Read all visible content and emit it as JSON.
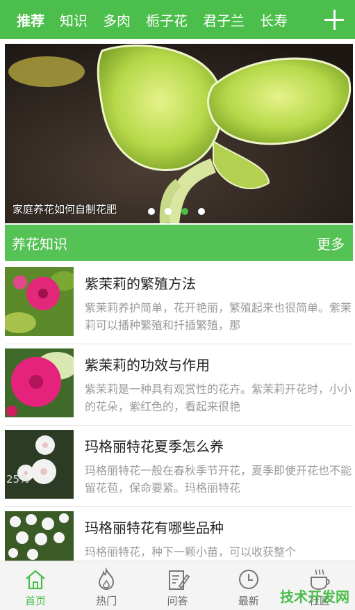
{
  "topbar": {
    "tabs": [
      "推荐",
      "知识",
      "多肉",
      "栀子花",
      "君子兰",
      "长寿"
    ],
    "add_icon": "plus-icon"
  },
  "banner": {
    "caption": "家庭养花如何自制花肥",
    "dots_count": 4,
    "active_dot": 2
  },
  "section": {
    "title": "养花知识",
    "more": "更多"
  },
  "articles": [
    {
      "title": "紫茉莉的繁殖方法",
      "desc": "紫茉莉养护简单，花开艳丽，繁殖起来也很简单。紫茉莉可以播种繁殖和扦插繁殖，那"
    },
    {
      "title": "紫茉莉的功效与作用",
      "desc": "紫茉莉是一种具有观赏性的花卉。紫茉莉开花时，小小的花朵，紫红色的，看起来很艳"
    },
    {
      "title": "玛格丽特花夏季怎么养",
      "desc": "玛格丽特花一般在春秋季节开花，夏季即使开花也不能留花苞，保命要紧。玛格丽特花",
      "overlay": "25%"
    },
    {
      "title": "玛格丽特花有哪些品种",
      "desc": "玛格丽特花，种下一颗小苗，可以收获整个"
    }
  ],
  "bottom_nav": [
    {
      "label": "首页",
      "icon": "home-icon"
    },
    {
      "label": "热门",
      "icon": "flame-icon"
    },
    {
      "label": "问答",
      "icon": "edit-icon"
    },
    {
      "label": "最新",
      "icon": "clock-icon"
    },
    {
      "label": "社区",
      "icon": "coffee-cup-icon"
    }
  ],
  "watermark": "技术开发网",
  "colors": {
    "accent": "#4cbe4c"
  }
}
